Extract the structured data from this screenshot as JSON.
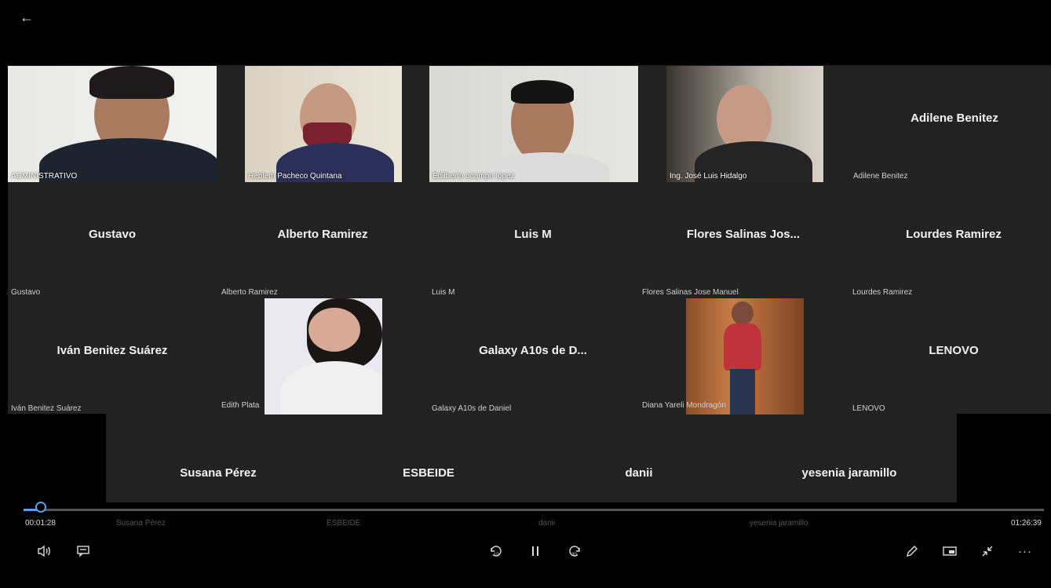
{
  "header": {
    "back_glyph": "←"
  },
  "video_tiles": [
    {
      "label": "ADMINISTRATIVO"
    },
    {
      "label": "Heblem Pacheco Quintana"
    },
    {
      "label": "Edilberto ocampo lopez"
    },
    {
      "label": "Ing. José Luis Hidalgo"
    },
    {
      "label": "Edith Plata"
    },
    {
      "label": "Diana Yareli Mondragón"
    }
  ],
  "name_tiles": [
    {
      "big": "Adilene Benitez",
      "label": "Adilene Benitez"
    },
    {
      "big": "Gustavo",
      "label": "Gustavo"
    },
    {
      "big": "Alberto Ramirez",
      "label": "Alberto Ramirez"
    },
    {
      "big": "Luis M",
      "label": "Luis M"
    },
    {
      "big": "Flores Salinas Jos...",
      "label": "Flores Salinas Jose Manuel"
    },
    {
      "big": "Lourdes Ramirez",
      "label": "Lourdes Ramirez"
    },
    {
      "big": "Iván Benitez Suárez",
      "label": "Iván Benitez Suárez"
    },
    {
      "big": "Galaxy A10s de D...",
      "label": "Galaxy A10s de Daniel"
    },
    {
      "big": "LENOVO",
      "label": "LENOVO"
    },
    {
      "big": "Susana Pérez",
      "label": "Susana Pérez"
    },
    {
      "big": "ESBEIDE",
      "label": "ESBEIDE"
    },
    {
      "big": "danii",
      "label": "danii"
    },
    {
      "big": "yesenia jaramillo",
      "label": "yesenia jaramillo"
    }
  ],
  "player": {
    "current_time": "00:01:28",
    "total_time": "01:26:39",
    "progress_fraction": 0.017,
    "icons": [
      "volume-icon",
      "captions-icon",
      "skip-back-10-icon",
      "pause-icon",
      "skip-forward-30-icon",
      "pen-icon",
      "miniplayer-icon",
      "exit-fullscreen-icon",
      "more-icon"
    ],
    "skip_back_label": "10",
    "skip_forward_label": "30",
    "more_glyph": "···"
  },
  "colors": {
    "accent": "#5aa0e6",
    "tile_bg": "#222222",
    "background": "#000000"
  }
}
